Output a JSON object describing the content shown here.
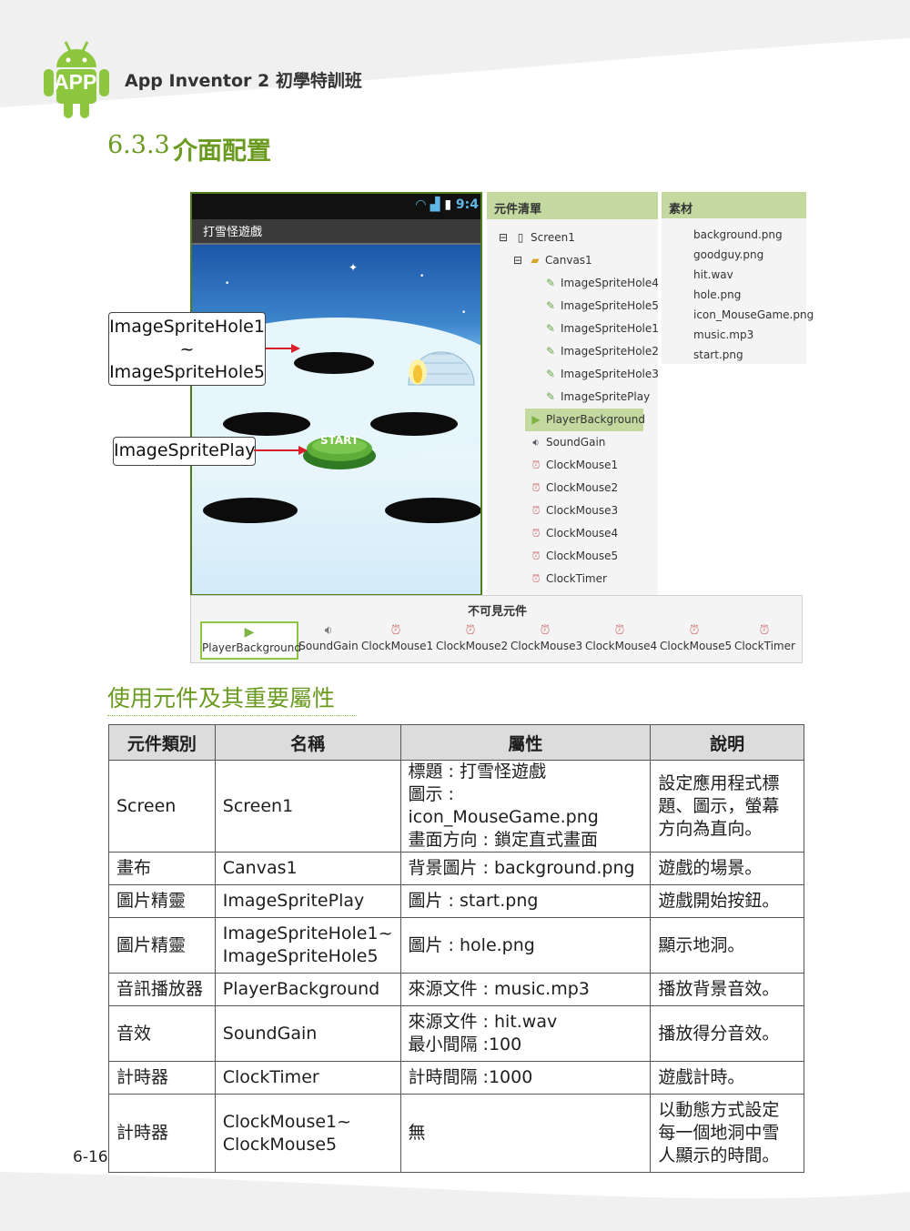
{
  "header": {
    "logo_text": "APP",
    "book_title": "App Inventor 2 初學特訓班",
    "section_number": "6.3.3",
    "section_title": "介面配置"
  },
  "phone": {
    "status_time": "9:4",
    "app_title": "打雪怪遊戲",
    "start_button_label": "START"
  },
  "callouts": {
    "holes_line1": "ImageSpriteHole1",
    "holes_tilde": "~",
    "holes_line2": "ImageSpriteHole5",
    "play": "ImageSpritePlay"
  },
  "components_panel": {
    "title": "元件清單",
    "items": [
      {
        "label": "Screen1",
        "icon": "screen-icon",
        "level": 0
      },
      {
        "label": "Canvas1",
        "icon": "canvas-icon",
        "level": 1
      },
      {
        "label": "ImageSpriteHole4",
        "icon": "sprite-icon",
        "level": 2
      },
      {
        "label": "ImageSpriteHole5",
        "icon": "sprite-icon",
        "level": 2
      },
      {
        "label": "ImageSpriteHole1",
        "icon": "sprite-icon",
        "level": 2
      },
      {
        "label": "ImageSpriteHole2",
        "icon": "sprite-icon",
        "level": 2
      },
      {
        "label": "ImageSpriteHole3",
        "icon": "sprite-icon",
        "level": 2
      },
      {
        "label": "ImageSpritePlay",
        "icon": "sprite-icon",
        "level": 2
      },
      {
        "label": "PlayerBackground",
        "icon": "player-icon",
        "level": 1,
        "selected": true
      },
      {
        "label": "SoundGain",
        "icon": "sound-icon",
        "level": 1
      },
      {
        "label": "ClockMouse1",
        "icon": "clock-icon",
        "level": 1
      },
      {
        "label": "ClockMouse2",
        "icon": "clock-icon",
        "level": 1
      },
      {
        "label": "ClockMouse3",
        "icon": "clock-icon",
        "level": 1
      },
      {
        "label": "ClockMouse4",
        "icon": "clock-icon",
        "level": 1
      },
      {
        "label": "ClockMouse5",
        "icon": "clock-icon",
        "level": 1
      },
      {
        "label": "ClockTimer",
        "icon": "clock-icon",
        "level": 1
      }
    ]
  },
  "media_panel": {
    "title": "素材",
    "items": [
      "background.png",
      "goodguy.png",
      "hit.wav",
      "hole.png",
      "icon_MouseGame.png",
      "music.mp3",
      "start.png"
    ]
  },
  "nonvisible": {
    "title": "不可見元件",
    "items": [
      {
        "label": "PlayerBackground",
        "icon": "player-icon",
        "selected": true
      },
      {
        "label": "SoundGain",
        "icon": "sound-icon"
      },
      {
        "label": "ClockMouse1",
        "icon": "clock-icon"
      },
      {
        "label": "ClockMouse2",
        "icon": "clock-icon"
      },
      {
        "label": "ClockMouse3",
        "icon": "clock-icon"
      },
      {
        "label": "ClockMouse4",
        "icon": "clock-icon"
      },
      {
        "label": "ClockMouse5",
        "icon": "clock-icon"
      },
      {
        "label": "ClockTimer",
        "icon": "clock-icon"
      }
    ]
  },
  "table": {
    "heading": "使用元件及其重要屬性",
    "columns": [
      "元件類別",
      "名稱",
      "屬性",
      "說明"
    ],
    "rows": [
      {
        "type": "Screen",
        "name": [
          "Screen1"
        ],
        "props": [
          "標題 : 打雪怪遊戲",
          "圖示 : icon_MouseGame.png",
          "畫面方向 : 鎖定直式畫面"
        ],
        "desc": [
          "設定應用程式標",
          "題、圖示，螢幕",
          "方向為直向。"
        ]
      },
      {
        "type": "畫布",
        "name": [
          "Canvas1"
        ],
        "props": [
          "背景圖片 : background.png"
        ],
        "desc": [
          "遊戲的場景。"
        ]
      },
      {
        "type": "圖片精靈",
        "name": [
          "ImageSpritePlay"
        ],
        "props": [
          "圖片 : start.png"
        ],
        "desc": [
          "遊戲開始按鈕。"
        ]
      },
      {
        "type": "圖片精靈",
        "name": [
          "ImageSpriteHole1~",
          "ImageSpriteHole5"
        ],
        "props": [
          "圖片 : hole.png"
        ],
        "desc": [
          "顯示地洞。"
        ]
      },
      {
        "type": "音訊播放器",
        "name": [
          "PlayerBackground"
        ],
        "props": [
          "來源文件 : music.mp3"
        ],
        "desc": [
          "播放背景音效。"
        ]
      },
      {
        "type": "音效",
        "name": [
          "SoundGain"
        ],
        "props": [
          "來源文件 : hit.wav",
          "最小間隔 :100"
        ],
        "desc": [
          "播放得分音效。"
        ]
      },
      {
        "type": "計時器",
        "name": [
          "ClockTimer"
        ],
        "props": [
          "計時間隔 :1000"
        ],
        "desc": [
          "遊戲計時。"
        ]
      },
      {
        "type": "計時器",
        "name": [
          "ClockMouse1~",
          "ClockMouse5"
        ],
        "props": [
          "無"
        ],
        "desc": [
          "以動態方式設定",
          "每一個地洞中雪",
          "人顯示的時間。"
        ]
      }
    ]
  },
  "page_number": "6-16",
  "colors": {
    "accent_green": "#6a9a1f",
    "panel_green": "#c3d9a0",
    "android_green": "#8dc63f"
  }
}
